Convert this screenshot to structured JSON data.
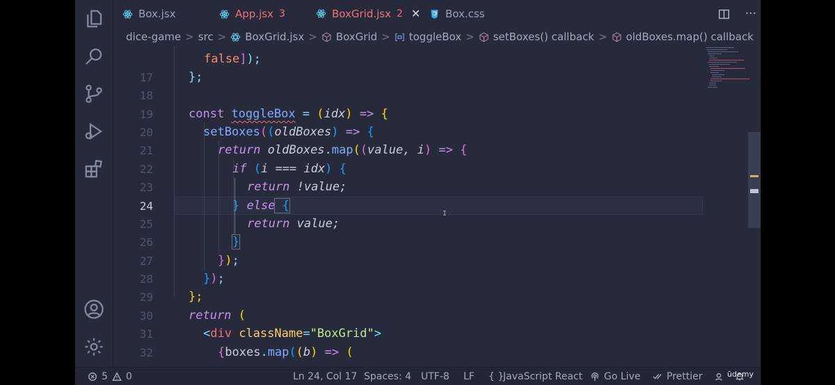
{
  "tabs": [
    {
      "label": "Box.jsx",
      "icon": "react-icon",
      "badge": "",
      "state": "normal"
    },
    {
      "label": "App.jsx",
      "icon": "react-icon",
      "badge": "3",
      "state": "error"
    },
    {
      "label": "BoxGrid.jsx",
      "icon": "react-icon",
      "badge": "2",
      "state": "active-error",
      "close": "✕"
    },
    {
      "label": "Box.css",
      "icon": "css-icon",
      "badge": "",
      "state": "normal"
    }
  ],
  "tab_actions": {
    "split": "▯▯",
    "more": "···"
  },
  "breadcrumb": [
    "dice-game",
    "src",
    "BoxGrid.jsx",
    "BoxGrid",
    "toggleBox",
    "setBoxes() callback",
    "oldBoxes.map() callback"
  ],
  "breadcrumb_sep": ">",
  "line_numbers": [
    "",
    "17",
    "18",
    "19",
    "20",
    "21",
    "22",
    "23",
    "24",
    "25",
    "26",
    "27",
    "28",
    "29",
    "30",
    "31",
    "32"
  ],
  "code": {
    "l16_a": "false",
    "l16_b": "]",
    "l16_c": ");",
    "l17": "};",
    "l19_kw": "const",
    "l19_fn": "toggleBox",
    "l19_eq": " = ",
    "l19_p1": "(",
    "l19_prm": "idx",
    "l19_p2": ")",
    "l19_arrow": " => ",
    "l19_b": "{",
    "l20_fn": "setBoxes",
    "l20_p1": "(",
    "l20_p2": "(",
    "l20_prm": "oldBoxes",
    "l20_p3": ")",
    "l20_arrow": " => ",
    "l20_b": "{",
    "l21_kw": "return",
    "l21_obj": " oldBoxes",
    "l21_dot": ".",
    "l21_fn": "map",
    "l21_p1": "(",
    "l21_p2": "(",
    "l21_prm": "value, i",
    "l21_p3": ")",
    "l21_arrow": " => ",
    "l21_b": "{",
    "l22_kw": "if",
    "l22_p1": " (",
    "l22_cond": "i === idx",
    "l22_p2": ")",
    "l22_b": " {",
    "l23_kw": "return",
    "l23_rest": " !value;",
    "l24_b": "}",
    "l24_kw": " else",
    "l24_b2": " {",
    "l25_kw": "return",
    "l25_rest": " value;",
    "l26": "}",
    "l27_b": "}",
    "l27_p": ")",
    "l27_s": ";",
    "l28_b": "}",
    "l28_p": ")",
    "l28_s": ";",
    "l29": "};",
    "l30_kw": "return",
    "l30_p": " (",
    "l31_lt": "<",
    "l31_tag": "div",
    "l31_attr": " className",
    "l31_eq": "=",
    "l31_str": "\"BoxGrid\"",
    "l31_gt": ">",
    "l32_b": "{",
    "l32_obj": "boxes",
    "l32_dot": ".",
    "l32_fn": "map",
    "l32_p1": "(",
    "l32_p2": "(",
    "l32_prm": "b",
    "l32_p3": ")",
    "l32_arrow": " => ",
    "l32_p4": "("
  },
  "status": {
    "errors": "5",
    "warnings": "0",
    "position": "Ln 24, Col 17",
    "spaces": "Spaces: 4",
    "encoding": "UTF-8",
    "eol": "LF",
    "braces": "{ }",
    "language": "JavaScript React",
    "golive": "Go Live",
    "prettier": "Prettier"
  },
  "watermark": "ūdemy",
  "colors": {
    "background": "#262a3a",
    "keyword": "#c792ea",
    "function": "#82aaff",
    "string": "#c3e88d",
    "error": "#f07178"
  }
}
